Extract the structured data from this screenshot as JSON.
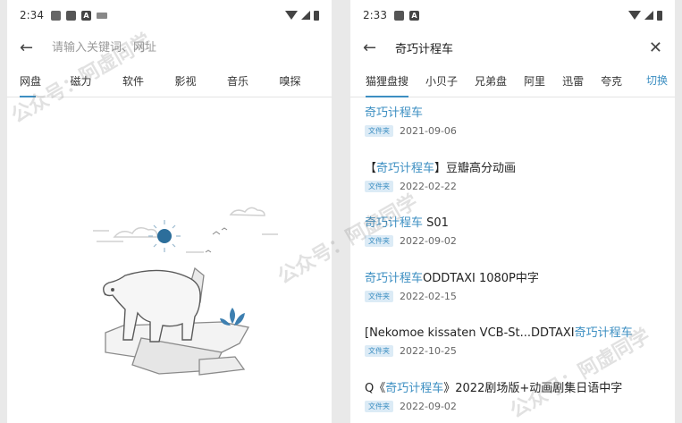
{
  "left": {
    "status": {
      "time": "2:34",
      "icons": [
        "image-icon",
        "square-icon",
        "a-icon",
        "keyboard-icon"
      ]
    },
    "search": {
      "placeholder": "请输入关键词、网址"
    },
    "tabs": [
      "网盘",
      "磁力",
      "软件",
      "影视",
      "音乐",
      "嗅探"
    ],
    "active_tab": 0
  },
  "right": {
    "status": {
      "time": "2:33",
      "icons": [
        "square-icon",
        "a-icon"
      ]
    },
    "search": {
      "value": "奇巧计程车"
    },
    "tabs": [
      "猫狸盘搜",
      "小贝子",
      "兄弟盘",
      "阿里",
      "迅雷",
      "夸克"
    ],
    "switch_label": "切换",
    "results": [
      {
        "pre": "",
        "hl": "奇巧计程车",
        "post": "",
        "badge": "文件夹",
        "date": "2021-09-06"
      },
      {
        "pre": "【",
        "hl": "奇巧计程车",
        "post": "】豆瓣高分动画",
        "badge": "文件夹",
        "date": "2022-02-22"
      },
      {
        "pre": "",
        "hl": "奇巧计程车",
        "post": " S01",
        "badge": "文件夹",
        "date": "2022-09-02"
      },
      {
        "pre": "",
        "hl": "奇巧计程车",
        "post": "ODDTAXI 1080P中字",
        "badge": "文件夹",
        "date": "2022-02-15"
      },
      {
        "pre": "[Nekomoe kissaten VCB-St...DDTAXI",
        "hl": "奇巧计程车",
        "post": "",
        "badge": "文件夹",
        "date": "2022-10-25"
      },
      {
        "pre": "Q《",
        "hl": "奇巧计程车",
        "post": "》2022剧场版+动画剧集日语中字",
        "badge": "文件夹",
        "date": "2022-09-02"
      }
    ]
  },
  "watermark": {
    "text": "公众号：阿虚同学"
  },
  "colors": {
    "accent": "#3d8fc2",
    "badge_bg": "#dcebf6",
    "sun": "#2c6e9b"
  }
}
